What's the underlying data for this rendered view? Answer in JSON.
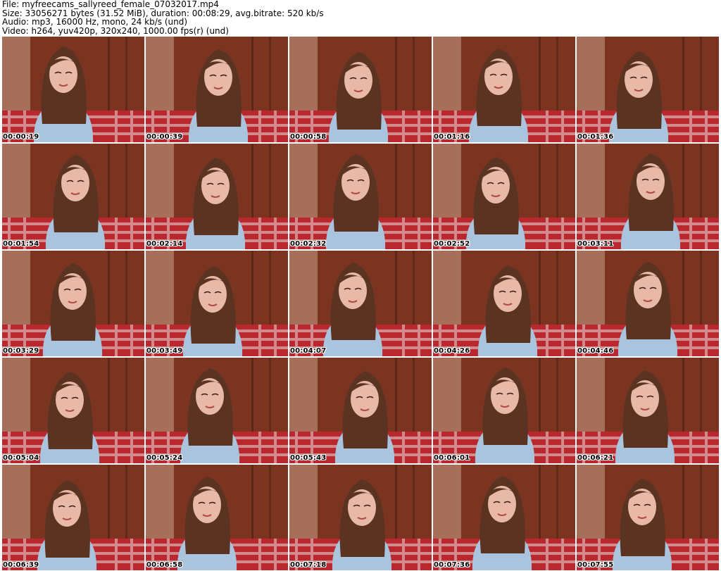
{
  "header": {
    "file_line": "File: myfreecams_sallyreed_female_07032017.mp4",
    "size_line": "Size: 33056271 bytes (31.52 MiB), duration: 00:08:29, avg.bitrate: 520 kb/s",
    "audio_line": "Audio: mp3, 16000 Hz, mono, 24 kb/s (und)",
    "video_line": "Video: h264, yuv420p, 320x240, 1000.00 fps(r) (und)"
  },
  "thumbnails": [
    {
      "timestamp": "00:00:19"
    },
    {
      "timestamp": "00:00:39"
    },
    {
      "timestamp": "00:00:58"
    },
    {
      "timestamp": "00:01:16"
    },
    {
      "timestamp": "00:01:36"
    },
    {
      "timestamp": "00:01:54"
    },
    {
      "timestamp": "00:02:14"
    },
    {
      "timestamp": "00:02:32"
    },
    {
      "timestamp": "00:02:52"
    },
    {
      "timestamp": "00:03:11"
    },
    {
      "timestamp": "00:03:29"
    },
    {
      "timestamp": "00:03:49"
    },
    {
      "timestamp": "00:04:07"
    },
    {
      "timestamp": "00:04:26"
    },
    {
      "timestamp": "00:04:46"
    },
    {
      "timestamp": "00:05:04"
    },
    {
      "timestamp": "00:05:24"
    },
    {
      "timestamp": "00:05:43"
    },
    {
      "timestamp": "00:06:01"
    },
    {
      "timestamp": "00:06:21"
    },
    {
      "timestamp": "00:06:39"
    },
    {
      "timestamp": "00:06:58"
    },
    {
      "timestamp": "00:07:18"
    },
    {
      "timestamp": "00:07:36"
    },
    {
      "timestamp": "00:07:55"
    }
  ],
  "colors": {
    "wall": "#7a3420",
    "wall_light": "#c9a089",
    "hair": "#5a3322",
    "skin": "#e8b9a6",
    "shirt": "#a9c4dc",
    "blanket_red": "#b8282e",
    "blanket_white": "#e9dcd6"
  }
}
